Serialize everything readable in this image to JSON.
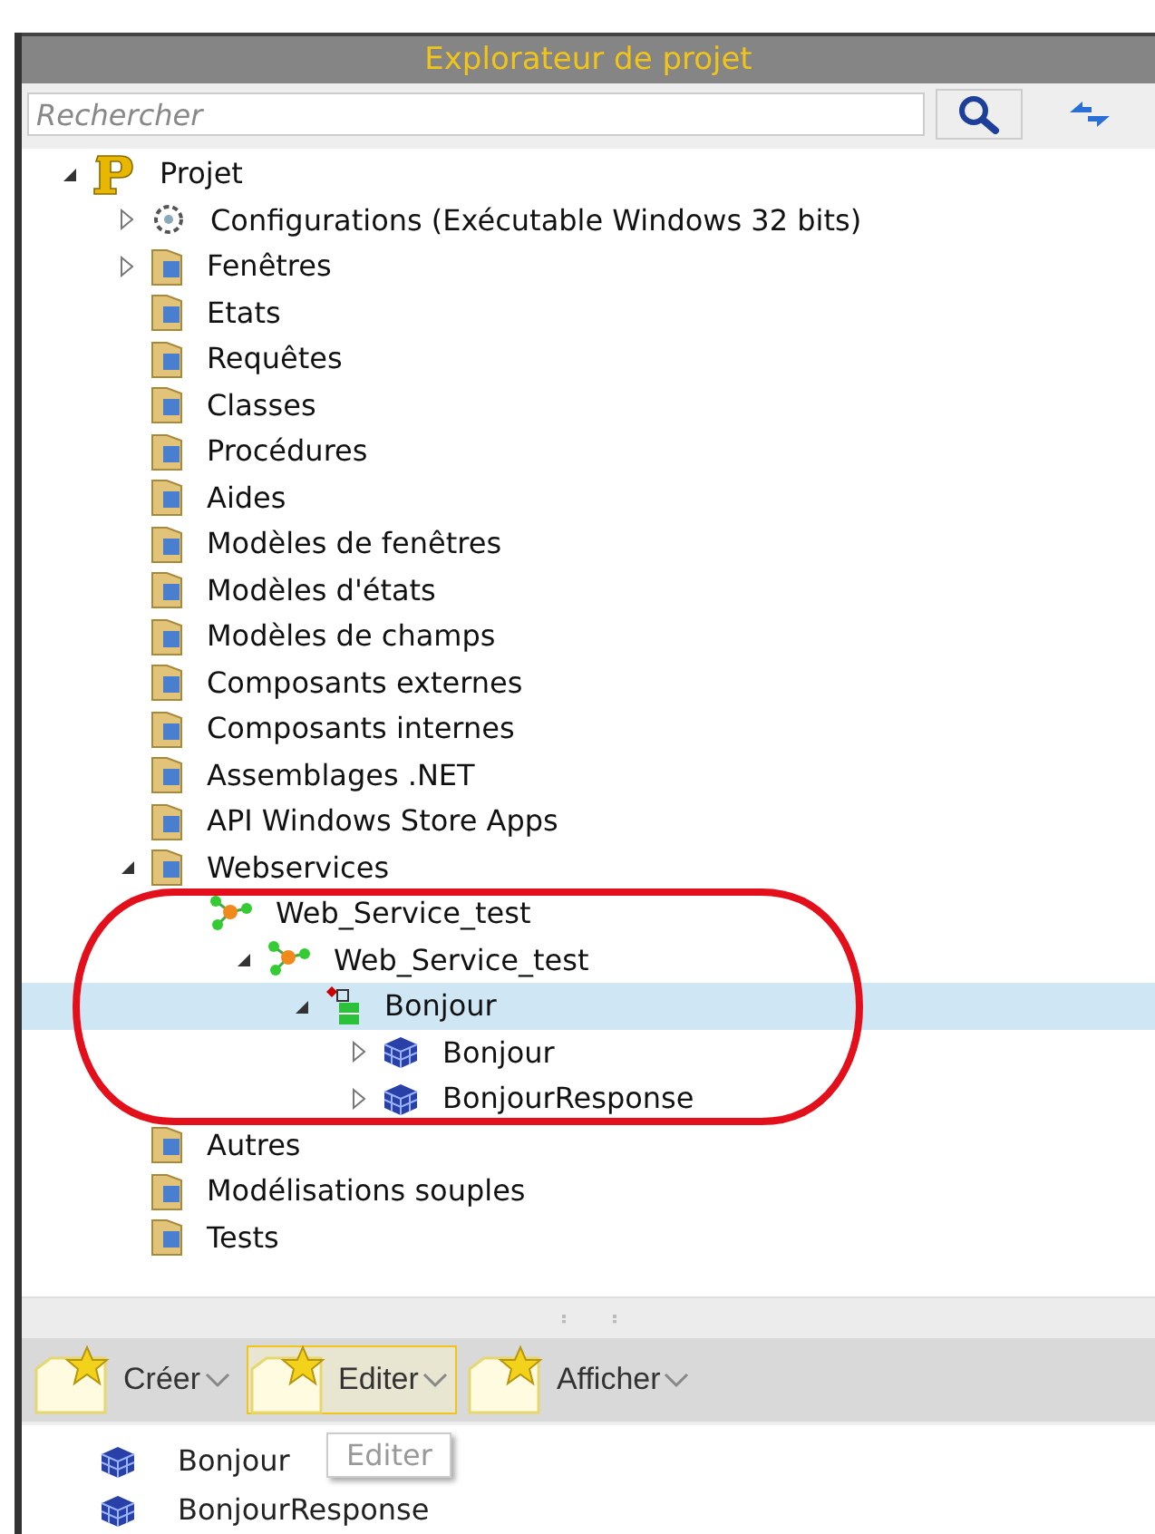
{
  "window": {
    "title": "Explorateur de projet"
  },
  "search": {
    "placeholder": "Rechercher"
  },
  "tree": [
    {
      "label": "Projet",
      "kind": "project",
      "expanded": true,
      "selected": false,
      "children": [
        {
          "label": "Configurations (Exécutable Windows 32 bits)",
          "kind": "gear",
          "expanded": false,
          "selected": false
        },
        {
          "label": "Fenêtres",
          "kind": "folder",
          "expanded": false,
          "selected": false
        },
        {
          "label": "Etats",
          "kind": "folder",
          "selected": false
        },
        {
          "label": "Requêtes",
          "kind": "folder",
          "selected": false
        },
        {
          "label": "Classes",
          "kind": "folder",
          "selected": false
        },
        {
          "label": "Procédures",
          "kind": "folder",
          "selected": false
        },
        {
          "label": "Aides",
          "kind": "folder",
          "selected": false
        },
        {
          "label": "Modèles de fenêtres",
          "kind": "folder",
          "selected": false
        },
        {
          "label": "Modèles d'états",
          "kind": "folder",
          "selected": false
        },
        {
          "label": "Modèles de champs",
          "kind": "folder",
          "selected": false
        },
        {
          "label": "Composants externes",
          "kind": "folder",
          "selected": false
        },
        {
          "label": "Composants internes",
          "kind": "folder",
          "selected": false
        },
        {
          "label": "Assemblages .NET",
          "kind": "folder",
          "selected": false
        },
        {
          "label": "API Windows Store Apps",
          "kind": "folder",
          "selected": false
        },
        {
          "label": "Webservices",
          "kind": "folder",
          "expanded": true,
          "selected": false,
          "children": [
            {
              "label": "Web_Service_test",
              "kind": "network",
              "selected": false,
              "children": [
                {
                  "label": "Web_Service_test",
                  "kind": "network",
                  "expanded": true,
                  "selected": false,
                  "children": [
                    {
                      "label": "Bonjour",
                      "kind": "method",
                      "expanded": true,
                      "selected": true,
                      "children": [
                        {
                          "label": "Bonjour",
                          "kind": "cube",
                          "expanded": false,
                          "selected": false
                        },
                        {
                          "label": "BonjourResponse",
                          "kind": "cube",
                          "expanded": false,
                          "selected": false
                        }
                      ]
                    }
                  ]
                }
              ]
            }
          ]
        },
        {
          "label": "Autres",
          "kind": "folder",
          "selected": false
        },
        {
          "label": "Modélisations souples",
          "kind": "folder",
          "selected": false
        },
        {
          "label": "Tests",
          "kind": "folder",
          "selected": false
        }
      ]
    }
  ],
  "toolbar": [
    {
      "label": "Créer",
      "highlighted": false
    },
    {
      "label": "Editer",
      "highlighted": true
    },
    {
      "label": "Afficher",
      "highlighted": false
    }
  ],
  "tooltip": "Editer",
  "details": [
    {
      "label": "Bonjour"
    },
    {
      "label": "BonjourResponse"
    }
  ]
}
